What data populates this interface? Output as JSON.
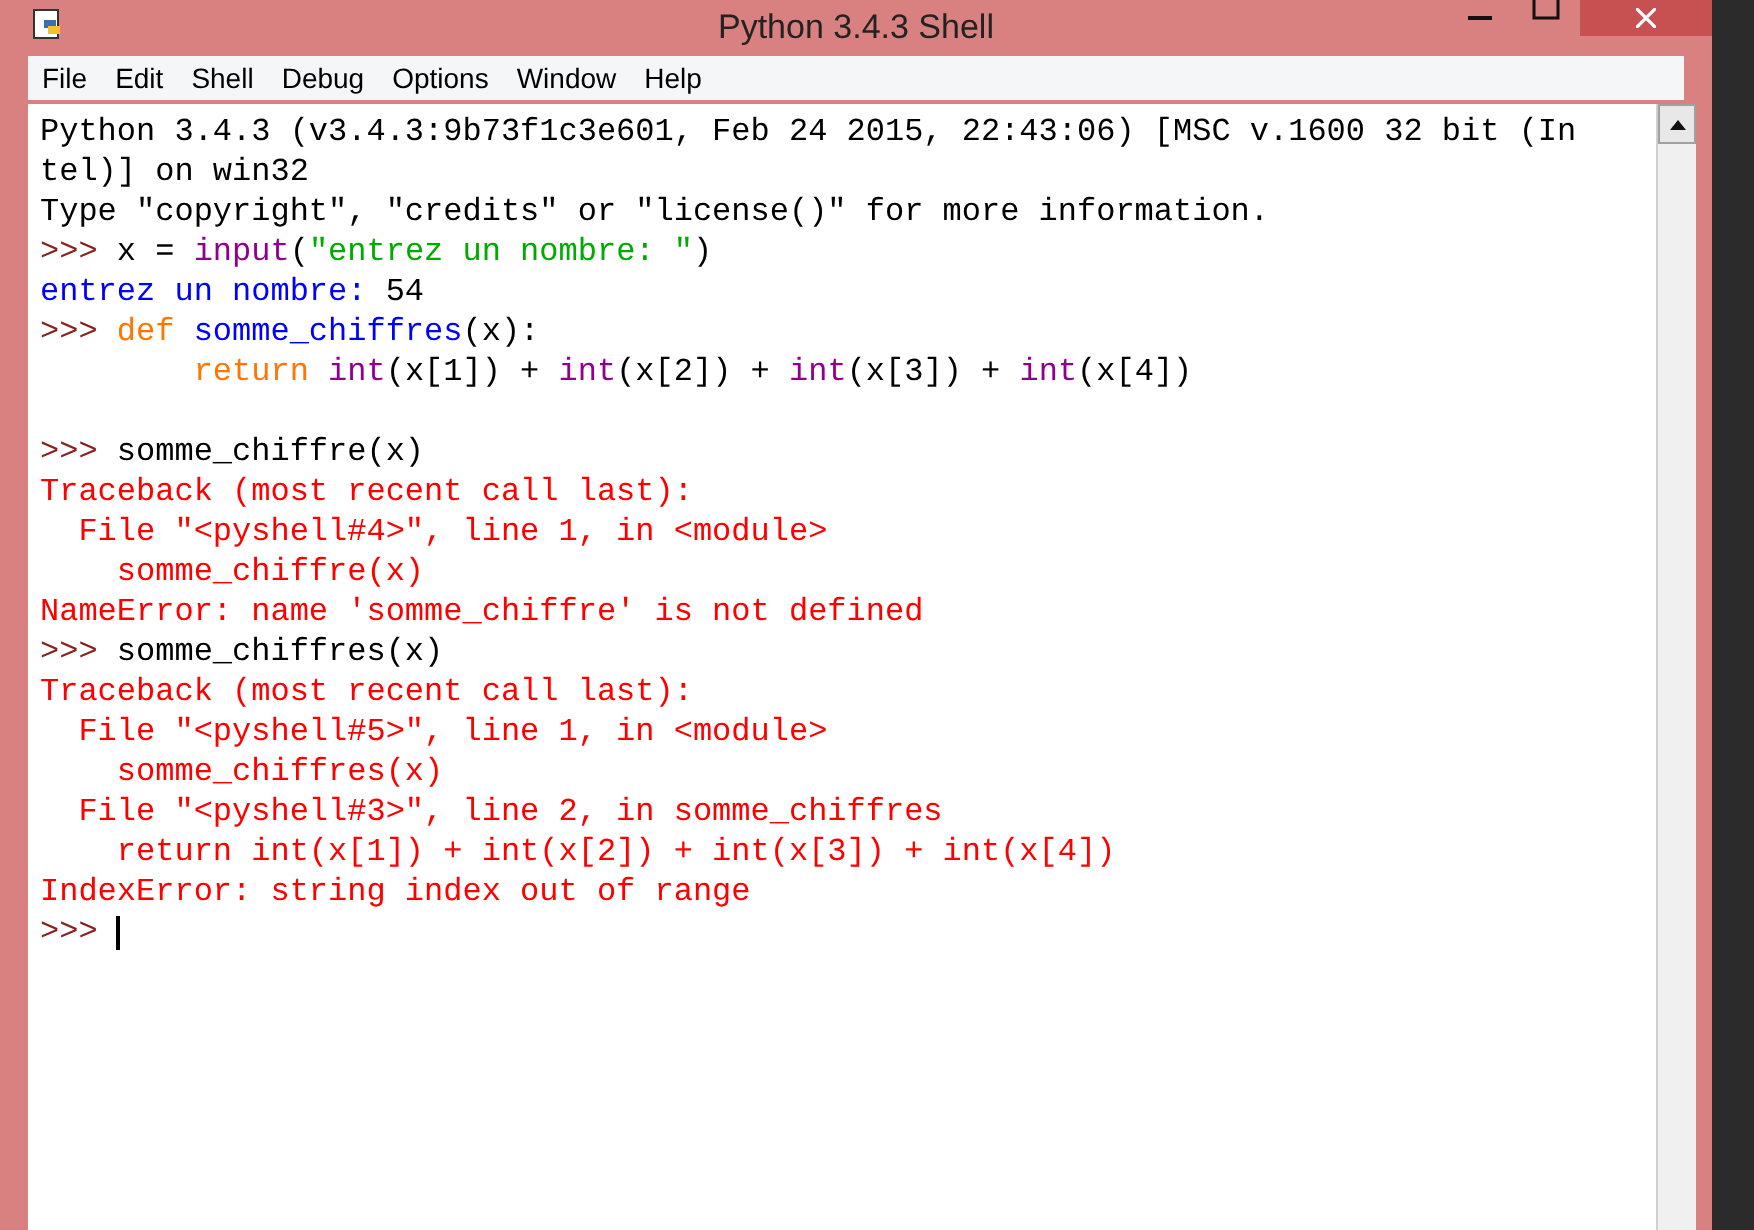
{
  "window": {
    "title": "Python 3.4.3 Shell"
  },
  "menu": [
    "File",
    "Edit",
    "Shell",
    "Debug",
    "Options",
    "Window",
    "Help"
  ],
  "lines": [
    {
      "kind": "text",
      "segments": [
        {
          "kind": "plain",
          "text": "Python 3.4.3 (v3.4.3:9b73f1c3e601, Feb 24 2015, 22:43:06) [MSC v.1600 32 bit (In"
        }
      ]
    },
    {
      "kind": "text",
      "segments": [
        {
          "kind": "plain",
          "text": "tel)] on win32"
        }
      ]
    },
    {
      "kind": "text",
      "segments": [
        {
          "kind": "plain",
          "text": "Type \"copyright\", \"credits\" or \"license()\" for more information."
        }
      ]
    },
    {
      "kind": "text",
      "segments": [
        {
          "kind": "prompt",
          "text": ">>> "
        },
        {
          "kind": "plain",
          "text": "x = "
        },
        {
          "kind": "builtin",
          "text": "input"
        },
        {
          "kind": "plain",
          "text": "("
        },
        {
          "kind": "string",
          "text": "\"entrez un nombre: \""
        },
        {
          "kind": "plain",
          "text": ")"
        }
      ]
    },
    {
      "kind": "text",
      "segments": [
        {
          "kind": "stdout",
          "text": "entrez un nombre: "
        },
        {
          "kind": "plain",
          "text": "54"
        }
      ]
    },
    {
      "kind": "text",
      "segments": [
        {
          "kind": "prompt",
          "text": ">>> "
        },
        {
          "kind": "keyword",
          "text": "def "
        },
        {
          "kind": "definition",
          "text": "somme_chiffres"
        },
        {
          "kind": "plain",
          "text": "(x):"
        }
      ]
    },
    {
      "kind": "text",
      "indent": true,
      "segments": [
        {
          "kind": "keyword",
          "text": "return "
        },
        {
          "kind": "builtin",
          "text": "int"
        },
        {
          "kind": "plain",
          "text": "(x[1]) + "
        },
        {
          "kind": "builtin",
          "text": "int"
        },
        {
          "kind": "plain",
          "text": "(x[2]) + "
        },
        {
          "kind": "builtin",
          "text": "int"
        },
        {
          "kind": "plain",
          "text": "(x[3]) + "
        },
        {
          "kind": "builtin",
          "text": "int"
        },
        {
          "kind": "plain",
          "text": "(x[4])"
        }
      ]
    },
    {
      "kind": "blank"
    },
    {
      "kind": "text",
      "segments": [
        {
          "kind": "prompt",
          "text": ">>> "
        },
        {
          "kind": "plain",
          "text": "somme_chiffre(x)"
        }
      ]
    },
    {
      "kind": "text",
      "segments": [
        {
          "kind": "error",
          "text": "Traceback (most recent call last):"
        }
      ]
    },
    {
      "kind": "text",
      "segments": [
        {
          "kind": "error",
          "text": "  File \"<pyshell#4>\", line 1, in <module>"
        }
      ]
    },
    {
      "kind": "text",
      "segments": [
        {
          "kind": "error",
          "text": "    somme_chiffre(x)"
        }
      ]
    },
    {
      "kind": "text",
      "segments": [
        {
          "kind": "error",
          "text": "NameError: name 'somme_chiffre' is not defined"
        }
      ]
    },
    {
      "kind": "text",
      "segments": [
        {
          "kind": "prompt",
          "text": ">>> "
        },
        {
          "kind": "plain",
          "text": "somme_chiffres(x)"
        }
      ]
    },
    {
      "kind": "text",
      "segments": [
        {
          "kind": "error",
          "text": "Traceback (most recent call last):"
        }
      ]
    },
    {
      "kind": "text",
      "segments": [
        {
          "kind": "error",
          "text": "  File \"<pyshell#5>\", line 1, in <module>"
        }
      ]
    },
    {
      "kind": "text",
      "segments": [
        {
          "kind": "error",
          "text": "    somme_chiffres(x)"
        }
      ]
    },
    {
      "kind": "text",
      "segments": [
        {
          "kind": "error",
          "text": "  File \"<pyshell#3>\", line 2, in somme_chiffres"
        }
      ]
    },
    {
      "kind": "text",
      "segments": [
        {
          "kind": "error",
          "text": "    return int(x[1]) + int(x[2]) + int(x[3]) + int(x[4])"
        }
      ]
    },
    {
      "kind": "text",
      "segments": [
        {
          "kind": "error",
          "text": "IndexError: string index out of range"
        }
      ]
    },
    {
      "kind": "text",
      "cursor": true,
      "segments": [
        {
          "kind": "prompt",
          "text": ">>> "
        }
      ]
    }
  ]
}
